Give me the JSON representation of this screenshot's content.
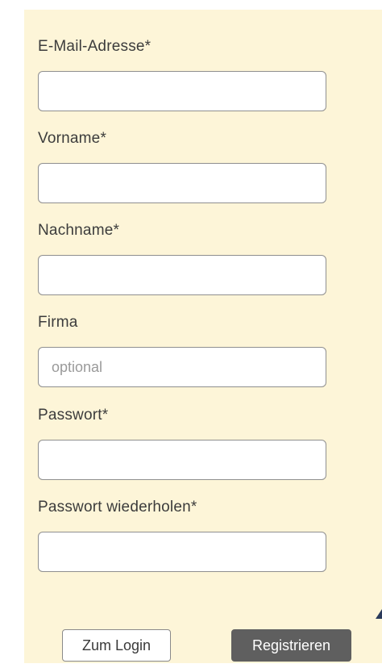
{
  "form": {
    "fields": [
      {
        "label": "E-Mail-Adresse*",
        "value": "",
        "placeholder": ""
      },
      {
        "label": "Vorname*",
        "value": "",
        "placeholder": ""
      },
      {
        "label": "Nachname*",
        "value": "",
        "placeholder": ""
      },
      {
        "label": "Firma",
        "value": "",
        "placeholder": "optional"
      },
      {
        "label": "Passwort*",
        "value": "",
        "placeholder": ""
      },
      {
        "label": "Passwort wiederholen*",
        "value": "",
        "placeholder": ""
      }
    ],
    "buttons": {
      "login_label": "Zum Login",
      "register_label": "Registrieren"
    }
  },
  "colors": {
    "panel_background": "#fdf5d8",
    "primary_button": "#5f5f5f",
    "input_border": "#8f8f8f"
  }
}
